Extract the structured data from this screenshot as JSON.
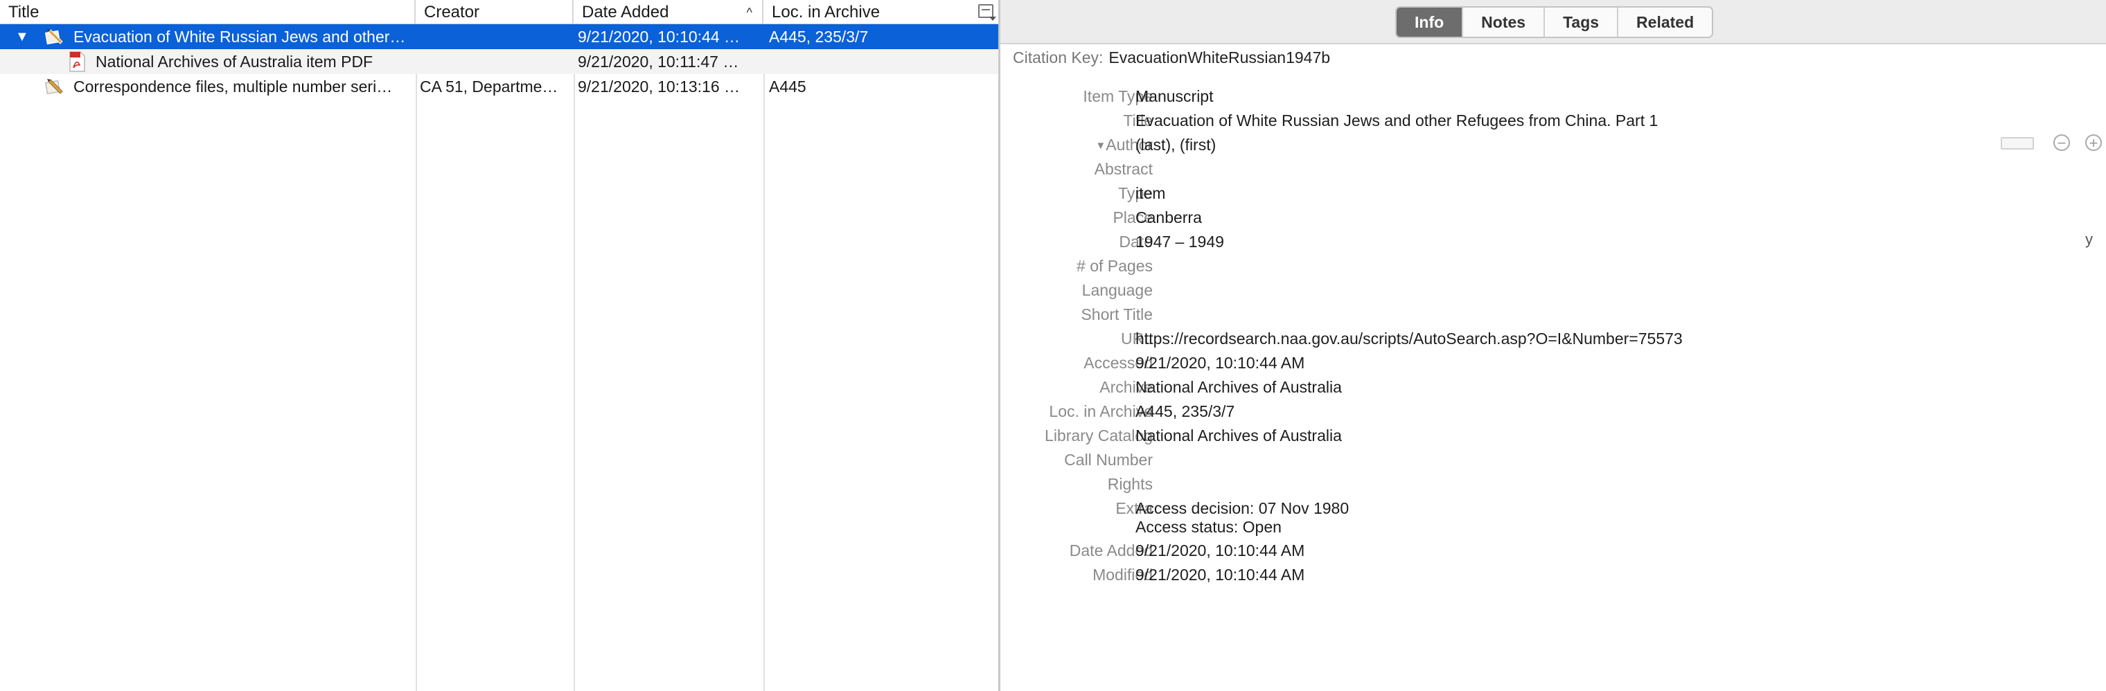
{
  "columns": {
    "title": "Title",
    "creator": "Creator",
    "date_added": "Date Added",
    "loc_in_archive": "Loc. in Archive"
  },
  "items": [
    {
      "title": "Evacuation of White Russian Jews and other…",
      "creator": "",
      "date_added": "9/21/2020, 10:10:44 …",
      "loc": "A445, 235/3/7"
    },
    {
      "title": "National Archives of Australia item PDF",
      "creator": "",
      "date_added": "9/21/2020, 10:11:47 …",
      "loc": ""
    },
    {
      "title": "Correspondence files, multiple number seri…",
      "creator": "CA 51, Departme…",
      "date_added": "9/21/2020, 10:13:16 …",
      "loc": "A445"
    }
  ],
  "tabs": [
    "Info",
    "Notes",
    "Tags",
    "Related"
  ],
  "citation": {
    "label": "Citation Key:",
    "value": "EvacuationWhiteRussian1947b"
  },
  "fields": {
    "item_type": {
      "label": "Item Type",
      "value": "Manuscript"
    },
    "title": {
      "label": "Title",
      "value": "Evacuation of White Russian Jews and other Refugees from China. Part 1"
    },
    "author": {
      "label": "Author",
      "value": "(last), (first)"
    },
    "abstract": {
      "label": "Abstract",
      "value": ""
    },
    "type": {
      "label": "Type",
      "value": "item"
    },
    "place": {
      "label": "Place",
      "value": "Canberra"
    },
    "date": {
      "label": "Date",
      "value": "1947 – 1949",
      "suffix": "y"
    },
    "pages": {
      "label": "# of Pages",
      "value": ""
    },
    "language": {
      "label": "Language",
      "value": ""
    },
    "short_title": {
      "label": "Short Title",
      "value": ""
    },
    "url": {
      "label": "URL",
      "value": "https://recordsearch.naa.gov.au/scripts/AutoSearch.asp?O=I&Number=75573"
    },
    "accessed": {
      "label": "Accessed",
      "value": "9/21/2020, 10:10:44 AM"
    },
    "archive": {
      "label": "Archive",
      "value": "National Archives of Australia"
    },
    "loc_in_archive": {
      "label": "Loc. in Archive",
      "value": "A445, 235/3/7"
    },
    "library_catalog": {
      "label": "Library Catalog",
      "value": "National Archives of Australia"
    },
    "call_number": {
      "label": "Call Number",
      "value": ""
    },
    "rights": {
      "label": "Rights",
      "value": ""
    },
    "extra": {
      "label": "Extra",
      "line1": "Access decision: 07 Nov 1980",
      "line2": "Access status: Open"
    },
    "date_added": {
      "label": "Date Added",
      "value": "9/21/2020, 10:10:44 AM"
    },
    "modified": {
      "label": "Modified",
      "value": "9/21/2020, 10:10:44 AM"
    }
  },
  "colors": {
    "selection": "#0a61d8",
    "active_tab": "#6d6d6d"
  }
}
